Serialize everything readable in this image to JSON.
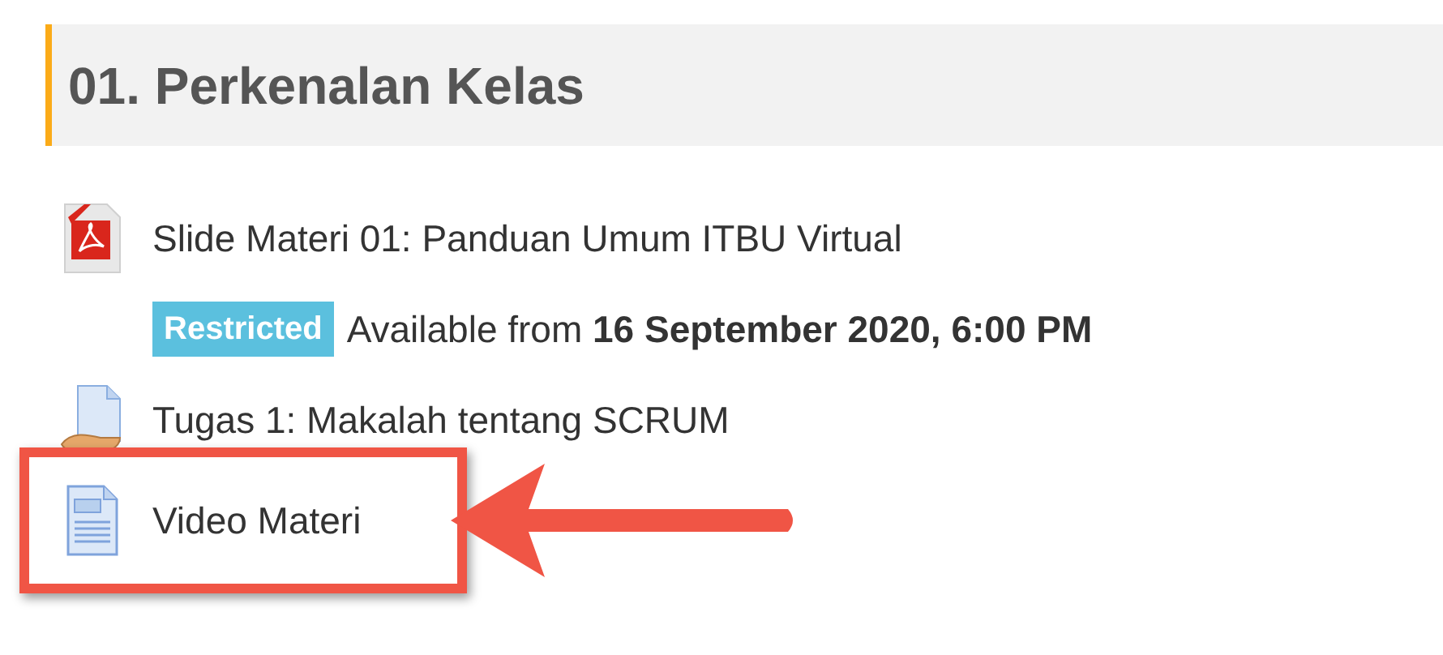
{
  "section": {
    "title": "01. Perkenalan Kelas"
  },
  "activities": [
    {
      "kind": "pdf",
      "title": "Slide Materi 01: Panduan Umum ITBU Virtual",
      "highlighted": false,
      "restriction": {
        "badge": "Restricted",
        "text": "Available from **16 September 2020, 6:00 PM**"
      }
    },
    {
      "kind": "assignment",
      "title": "Tugas 1: Makalah tentang SCRUM",
      "highlighted": false
    },
    {
      "kind": "page",
      "title": "Video Materi",
      "highlighted": true
    }
  ]
}
